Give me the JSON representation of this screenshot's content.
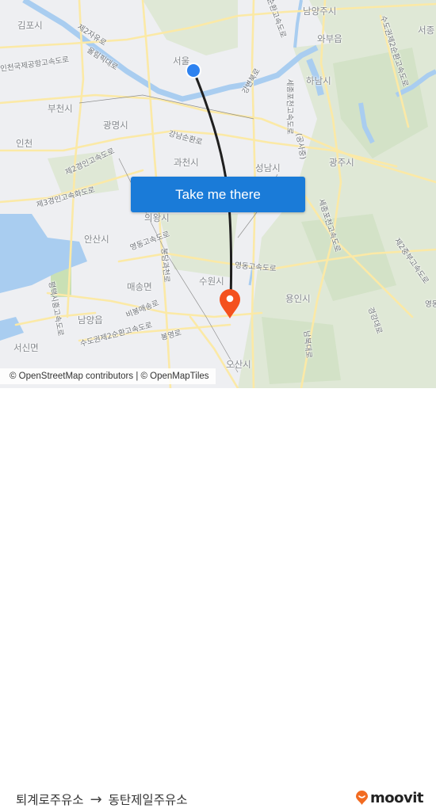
{
  "map": {
    "action_button_label": "Take me there",
    "attribution": "© OpenStreetMap contributors | © OpenMapTiles",
    "origin_marker_color": "#2e82f0",
    "destination_marker_color": "#f4511e",
    "route_color": "#1f1f1f",
    "place_labels": [
      {
        "name": "place-label-gimpo",
        "text": "김포시"
      },
      {
        "name": "place-label-seoul",
        "text": "서울"
      },
      {
        "name": "place-label-namyangju",
        "text": "남양주시"
      },
      {
        "name": "place-label-wabu",
        "text": "와부읍"
      },
      {
        "name": "place-label-seojong",
        "text": "서종"
      },
      {
        "name": "place-label-hanam",
        "text": "하남시"
      },
      {
        "name": "place-label-bucheon",
        "text": "부천시"
      },
      {
        "name": "place-label-gwangmyeong",
        "text": "광명시"
      },
      {
        "name": "place-label-incheon",
        "text": "인천"
      },
      {
        "name": "place-label-gwacheon",
        "text": "과천시"
      },
      {
        "name": "place-label-seongnam",
        "text": "성남시"
      },
      {
        "name": "place-label-gwangju",
        "text": "광주시"
      },
      {
        "name": "place-label-ansan",
        "text": "안산시"
      },
      {
        "name": "place-label-maesong",
        "text": "매송면"
      },
      {
        "name": "place-label-suwon",
        "text": "수원시"
      },
      {
        "name": "place-label-yongin",
        "text": "용인시"
      },
      {
        "name": "place-label-namyang",
        "text": "남양읍"
      },
      {
        "name": "place-label-seosin",
        "text": "서신면"
      },
      {
        "name": "place-label-osan",
        "text": "오산시"
      },
      {
        "name": "place-label-uiwang",
        "text": "의왕시"
      }
    ],
    "road_labels": [
      {
        "name": "road-label-jayu",
        "text": "제2자유로"
      },
      {
        "name": "road-label-olympic",
        "text": "올림픽대로"
      },
      {
        "name": "road-label-incheon-airport",
        "text": "인천국제공항고속도로"
      },
      {
        "name": "road-label-ring-north",
        "text": "순환고속도로"
      },
      {
        "name": "road-label-gangbyeon",
        "text": "강변북로"
      },
      {
        "name": "road-label-sejong-pocheon",
        "text": "세종포천고속도로"
      },
      {
        "name": "road-label-gongsa",
        "text": "(공사중)"
      },
      {
        "name": "road-label-capital-ring-2-north",
        "text": "수도권제2순환고속도로"
      },
      {
        "name": "road-label-gangnam-ring",
        "text": "강남순환로"
      },
      {
        "name": "road-label-gyeongin-2",
        "text": "제2경인고속도로"
      },
      {
        "name": "road-label-gyeongin-3",
        "text": "제3경인고속화도로"
      },
      {
        "name": "road-label-yeongdong-west",
        "text": "영동고속도로"
      },
      {
        "name": "road-label-yeongdong-east",
        "text": "영동고속도로"
      },
      {
        "name": "road-label-gwacheon-ro",
        "text": "봉담과천로"
      },
      {
        "name": "road-label-pyeongtaek-siheung",
        "text": "평택시흥고속도로"
      },
      {
        "name": "road-label-bibong-maesong",
        "text": "비봉매송로"
      },
      {
        "name": "road-label-capital-ring-2-south",
        "text": "수도권제2순환고속도로"
      },
      {
        "name": "road-label-bongyeong",
        "text": "봉영로"
      },
      {
        "name": "road-label-sejong-pocheon-south",
        "text": "세종포천고속도로"
      },
      {
        "name": "road-label-jungbu",
        "text": "제2중부고속도로"
      },
      {
        "name": "road-label-nambuk",
        "text": "남북대로"
      },
      {
        "name": "road-label-gyeonggang",
        "text": "경강대로"
      },
      {
        "name": "road-label-yeong",
        "text": "영동"
      }
    ]
  },
  "footer": {
    "origin": "퇴계로주유소",
    "arrow": "→",
    "destination": "동탄제일주유소",
    "brand": "moovit",
    "brand_color": "#f26b21"
  }
}
